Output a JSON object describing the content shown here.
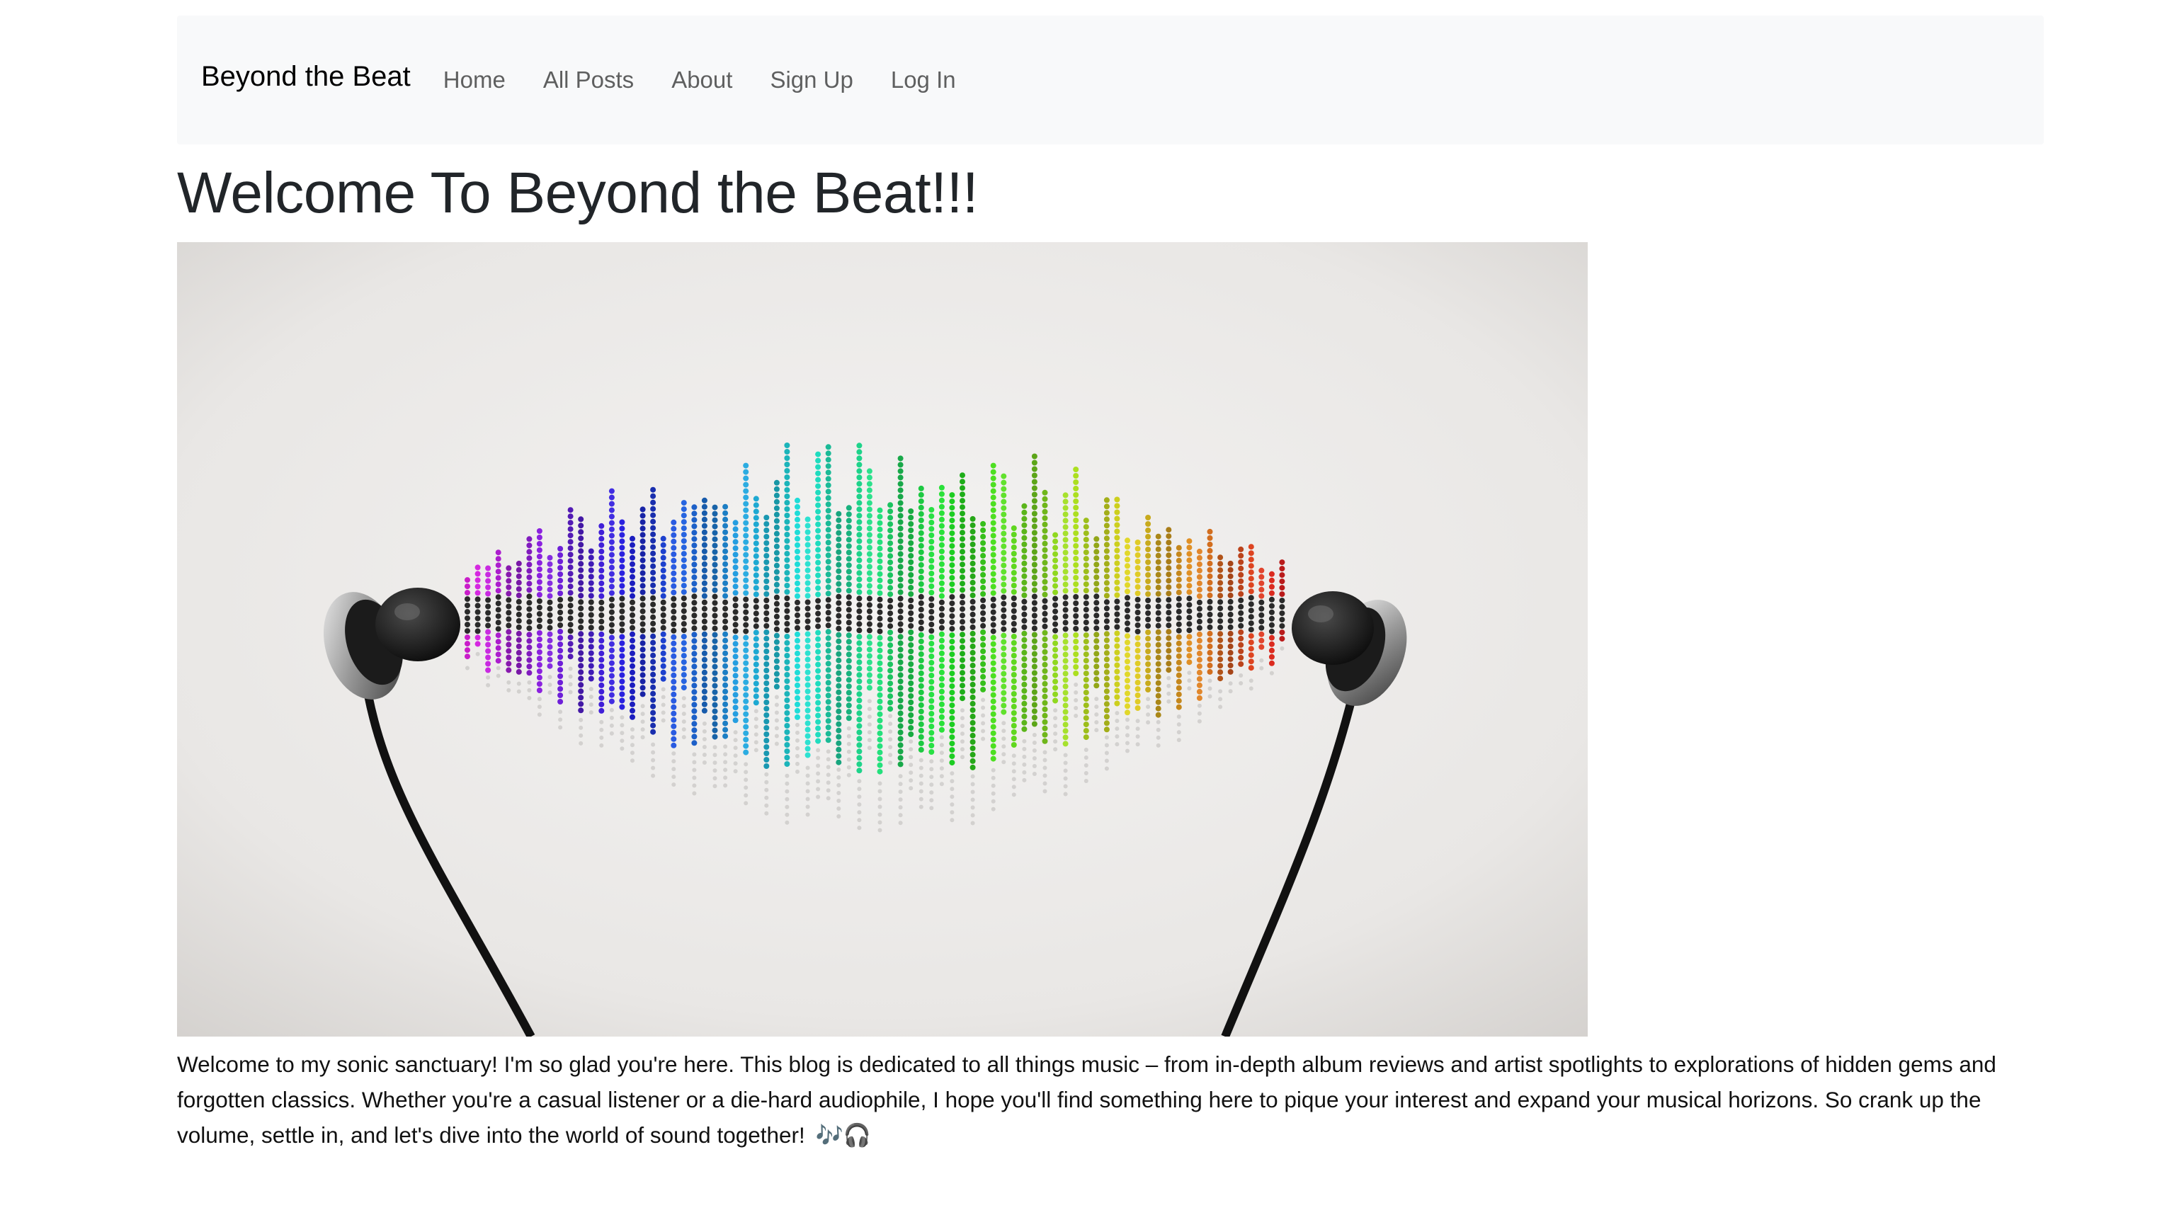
{
  "navbar": {
    "brand": "Beyond the Beat",
    "links": [
      "Home",
      "All Posts",
      "About",
      "Sign Up",
      "Log In"
    ]
  },
  "main": {
    "title": "Welcome To Beyond the Beat!!!",
    "hero_image": "headphones-soundwave-image",
    "intro": "Welcome to my sonic sanctuary! I'm so glad you're here. This blog is dedicated to all things music – from in-depth album reviews and artist spotlights to explorations of hidden gems and forgotten classics. Whether you're a casual listener or a die-hard audiophile, I hope you'll find something here to pique your interest and expand your musical horizons. So crank up the volume, settle in, and let's dive into the world of sound together!",
    "intro_emoji": "🎶🎧"
  },
  "colors": {
    "navbar_bg": "#f8f9fa",
    "text": "#212529",
    "nav_link": "rgba(0,0,0,0.62)"
  }
}
